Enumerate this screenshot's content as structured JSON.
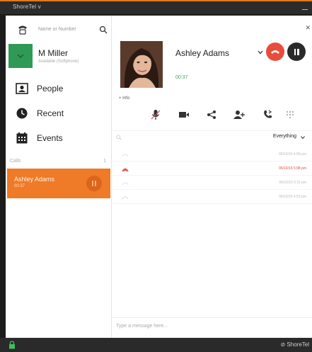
{
  "window": {
    "title": "ShoreTel  v"
  },
  "sidebar": {
    "search_placeholder": "Name or Number",
    "user": {
      "name": "M Miller",
      "status": "Available (Softphone)"
    },
    "nav": [
      {
        "label": "People",
        "icon": "person-card-icon"
      },
      {
        "label": "Recent",
        "icon": "clock-icon"
      },
      {
        "label": "Events",
        "icon": "calendar-icon"
      }
    ],
    "calls_label": "Calls",
    "calls_count": "1",
    "active_call": {
      "name": "Ashley Adams",
      "sub": "00:37"
    }
  },
  "call": {
    "contact_name": "Ashley Adams",
    "timer": "00:37",
    "info_link": "+ Info",
    "filter": "Everything",
    "history": [
      {
        "time": "06/10/15 4:58 pm",
        "missed": false
      },
      {
        "time": "06/10/15 5:08 pm",
        "missed": true
      },
      {
        "time": "06/10/15 5:11 pm",
        "missed": false
      },
      {
        "time": "06/10/15 4:53 pm",
        "missed": false
      }
    ],
    "message_placeholder": "Type a message here..."
  },
  "statusbar": {
    "brand": "ShoreTel"
  },
  "colors": {
    "accent": "#ef7a27",
    "presence": "#2f9a56",
    "hangup": "#e84c3d",
    "timer": "#3aa55e"
  }
}
